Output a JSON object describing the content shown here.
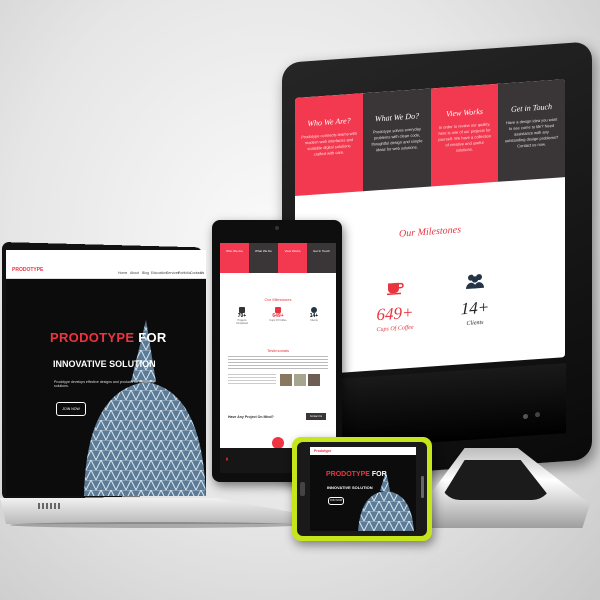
{
  "monitor": {
    "features": [
      {
        "title": "Who We Are?",
        "text": "Prodotype connects teams with modern web interfaces and scalable digital solutions crafted with care.",
        "color": "#f2394f"
      },
      {
        "title": "What We Do?",
        "text": "Prodotype solves everyday problems with clean code, thoughtful design and simple ideas for web solutions.",
        "color": "#3a3536"
      },
      {
        "title": "View Works",
        "text": "In order to review our quality, here is one of our projects for yourself. We have a collection of creative and useful solutions.",
        "color": "#f2394f"
      },
      {
        "title": "Get in Touch",
        "text": "Have a design idea you want to see come to life? Need assistance with any outstanding design problems? Contact us now.",
        "color": "#3a3536"
      }
    ],
    "milestones_title": "Our Milestones",
    "stats": [
      {
        "icon": "coffee-cup-icon",
        "value": "649+",
        "label": "Cups Of Coffee",
        "color": "#e8343f"
      },
      {
        "icon": "team-icon",
        "value": "14+",
        "label": "Clients",
        "color": "#222222"
      }
    ]
  },
  "tablet": {
    "cells": [
      "Who We Are",
      "What We Do",
      "View Works",
      "Get In Touch"
    ],
    "milestones_title": "Our Milestones",
    "stats": [
      {
        "value": "70+",
        "label": "Projects Completed"
      },
      {
        "value": "649+",
        "label": "Cups Of Coffee"
      },
      {
        "value": "14+",
        "label": "Clients"
      }
    ],
    "testimonials_title": "Testimonials",
    "cta_text": "Have Any Project On Mind?",
    "cta_button": "Contact Us"
  },
  "laptop": {
    "brand": "PRODOTYPE",
    "nav": [
      "Home",
      "About",
      "Blog",
      "Education",
      "Services",
      "Portfolio",
      "Contact",
      "Us"
    ],
    "hero_title_red": "PRODOTYPE",
    "hero_title_white": "FOR",
    "hero_subtitle": "INNOVATIVE SOLUTION",
    "hero_text": "Prodotype develops effective designs and products for innovative solutions.",
    "hero_button": "JOIN NOW"
  },
  "phone": {
    "brand": "Prodotype",
    "hero_title_red": "PRODOTYPE",
    "hero_title_white": "FOR",
    "hero_subtitle": "INNOVATIVE SOLUTION",
    "hero_button": "JOIN NOW"
  },
  "colors": {
    "accent": "#ef3340",
    "dark": "#3a3536",
    "phone_case": "#c6e51b"
  }
}
